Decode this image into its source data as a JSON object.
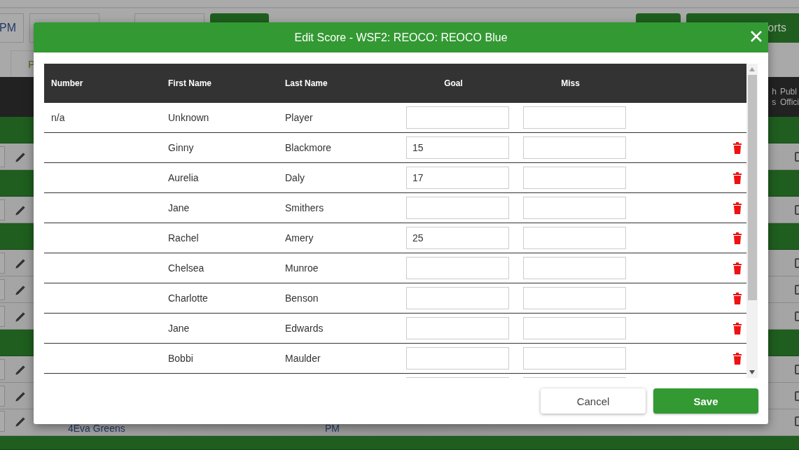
{
  "background": {
    "toolbar_field": "PM",
    "tab": "P",
    "reports_button": "orts",
    "header_columns": [
      "h\ns",
      "Publ\nOffici"
    ],
    "rows": [
      {
        "kind": "group"
      },
      {
        "kind": "entry",
        "checked": false
      },
      {
        "kind": "group"
      },
      {
        "kind": "entry",
        "checked": false
      },
      {
        "kind": "group"
      },
      {
        "kind": "entry",
        "checked": false
      },
      {
        "kind": "entry",
        "checked": false
      },
      {
        "kind": "entry",
        "checked": false
      },
      {
        "kind": "group"
      },
      {
        "kind": "entry",
        "checked": false
      },
      {
        "kind": "entry",
        "checked": false
      },
      {
        "kind": "entry",
        "team": "4Eva Greens",
        "time": "PM",
        "checked": false
      },
      {
        "kind": "group"
      }
    ]
  },
  "dialog": {
    "title": "Edit Score - WSF2: REOCO: REOCO Blue",
    "columns": [
      "Number",
      "First Name",
      "Last Name",
      "Goal",
      "Miss"
    ],
    "rows": [
      {
        "number": "n/a",
        "first_name": "Unknown",
        "last_name": "Player",
        "deletable": false
      },
      {
        "first_name": "Ginny",
        "last_name": "Blackmore",
        "goal": "15",
        "deletable": true
      },
      {
        "first_name": "Aurelia",
        "last_name": "Daly",
        "goal": "17",
        "deletable": true
      },
      {
        "first_name": "Jane",
        "last_name": "Smithers",
        "deletable": true
      },
      {
        "first_name": "Rachel",
        "last_name": "Amery",
        "goal": "25",
        "deletable": true
      },
      {
        "first_name": "Chelsea",
        "last_name": "Munroe",
        "deletable": true
      },
      {
        "first_name": "Charlotte",
        "last_name": "Benson",
        "deletable": true
      },
      {
        "first_name": "Jane",
        "last_name": "Edwards",
        "deletable": true
      },
      {
        "first_name": "Bobbi",
        "last_name": "Maulder",
        "deletable": true
      },
      {}
    ],
    "buttons": [
      {
        "label": "Cancel",
        "kind": "secondary"
      },
      {
        "label": "Save",
        "kind": "primary"
      }
    ]
  }
}
